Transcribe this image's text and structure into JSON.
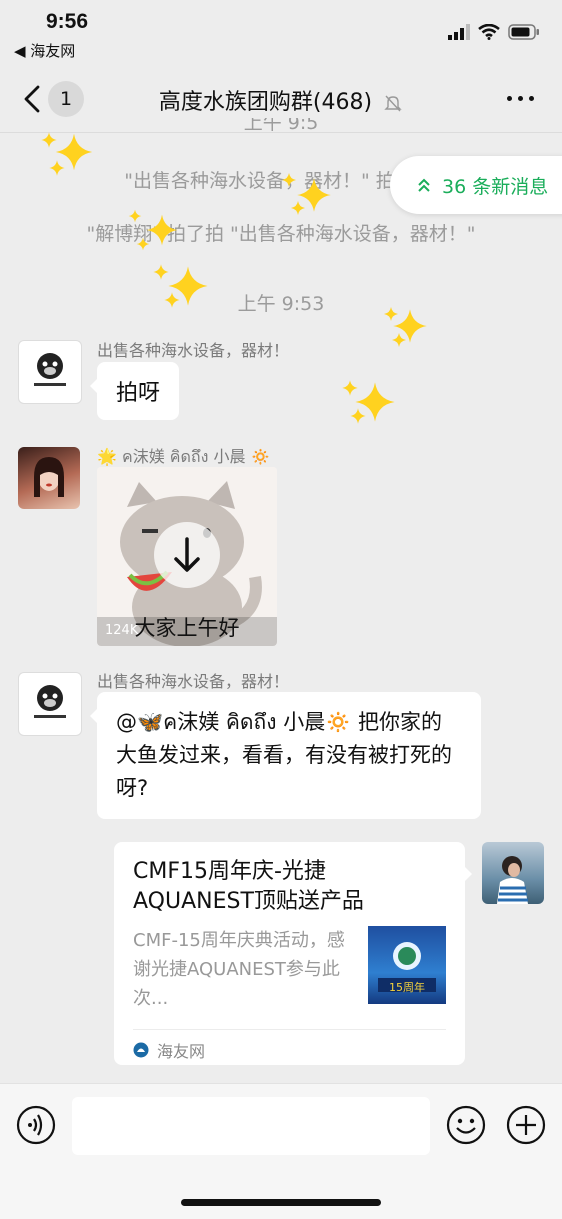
{
  "status_bar": {
    "time": "9:56",
    "back_app": "◀ 海友网"
  },
  "nav": {
    "unread_count": "1",
    "title": "高度水族团购群(468)"
  },
  "system": {
    "cut_time": "上午 9:5",
    "pat1": "\"出售各种海水设备，器材！\" 拍了",
    "pat2": "\"解博翔\" 拍了拍 \"出售各种海水设备，器材！\"",
    "time2": "上午 9:53"
  },
  "new_messages": {
    "label": "36 条新消息"
  },
  "messages": [
    {
      "sender": "出售各种海水设备，器材！",
      "text": "拍呀"
    },
    {
      "sender_prefix": "🌟",
      "sender": "ค沫媄 คิดถึง 小晨",
      "sender_suffix": "🔅",
      "sticker_size": "124K",
      "sticker_caption": "大家上午好"
    },
    {
      "sender": "出售各种海水设备，器材！",
      "text": "@🦋ค沫媄 คิดถึง 小晨🔅 把你家的大鱼发过来，看看，有没有被打死的呀?"
    },
    {
      "card_title": "CMF15周年庆-光捷AQUANEST顶贴送产品",
      "card_desc": "CMF-15周年庆典活动，感谢光捷AQUANEST参与此次...",
      "card_source": "海友网",
      "card_thumb_text": "15周年"
    }
  ],
  "colors": {
    "accent_green": "#1aad5a",
    "background": "#ededed",
    "sparkle": "#ffd21f"
  }
}
